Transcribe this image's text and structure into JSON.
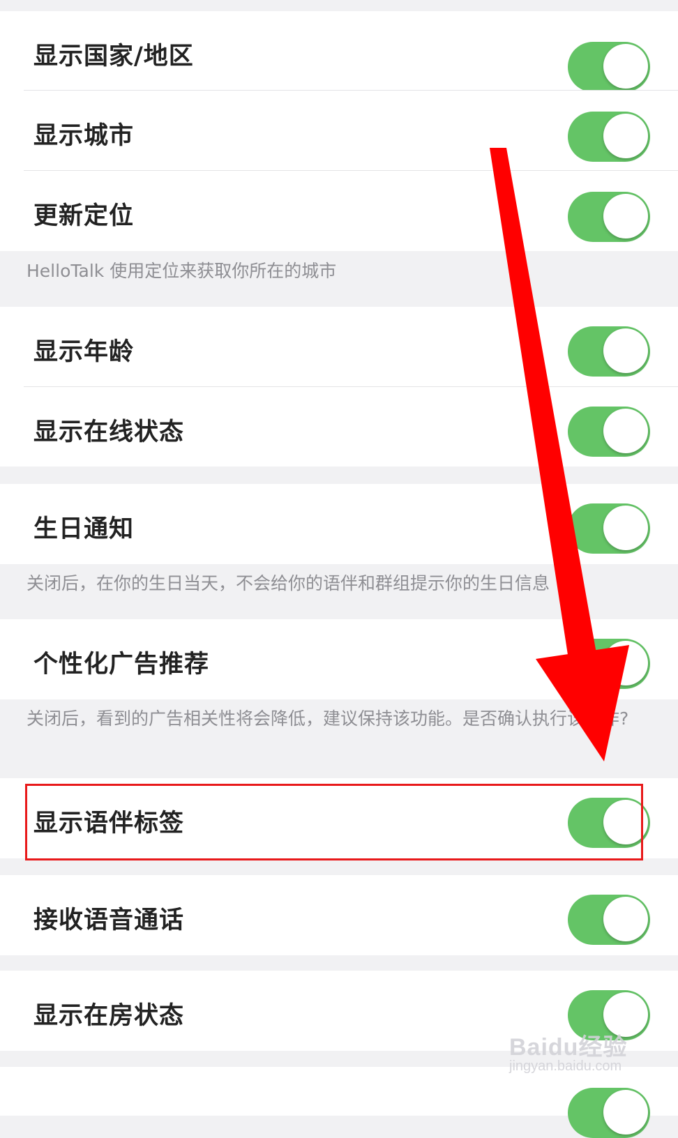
{
  "settings": [
    {
      "label": "显示国家/地区",
      "enabled": true
    },
    {
      "label": "显示城市",
      "enabled": true
    },
    {
      "label": "更新定位",
      "enabled": true
    },
    {
      "label": "显示年龄",
      "enabled": true
    },
    {
      "label": "显示在线状态",
      "enabled": true
    },
    {
      "label": "生日通知",
      "enabled": true
    },
    {
      "label": "个性化广告推荐",
      "enabled": true
    },
    {
      "label": "显示语伴标签",
      "enabled": true
    },
    {
      "label": "接收语音通话",
      "enabled": true
    },
    {
      "label": "显示在房状态",
      "enabled": true
    }
  ],
  "notes": {
    "location": "HelloTalk 使用定位来获取你所在的城市",
    "birthday": "关闭后，在你的生日当天，不会给你的语伴和群组提示你的生日信息",
    "ads": "关闭后，看到的广告相关性将会降低，建议保持该功能。是否确认执行该操作?"
  },
  "watermark": {
    "logo": "Baidu经验",
    "url": "jingyan.baidu.com"
  },
  "colors": {
    "toggle_on": "#64c466",
    "highlight": "#e8191a",
    "arrow": "#ff0000"
  }
}
